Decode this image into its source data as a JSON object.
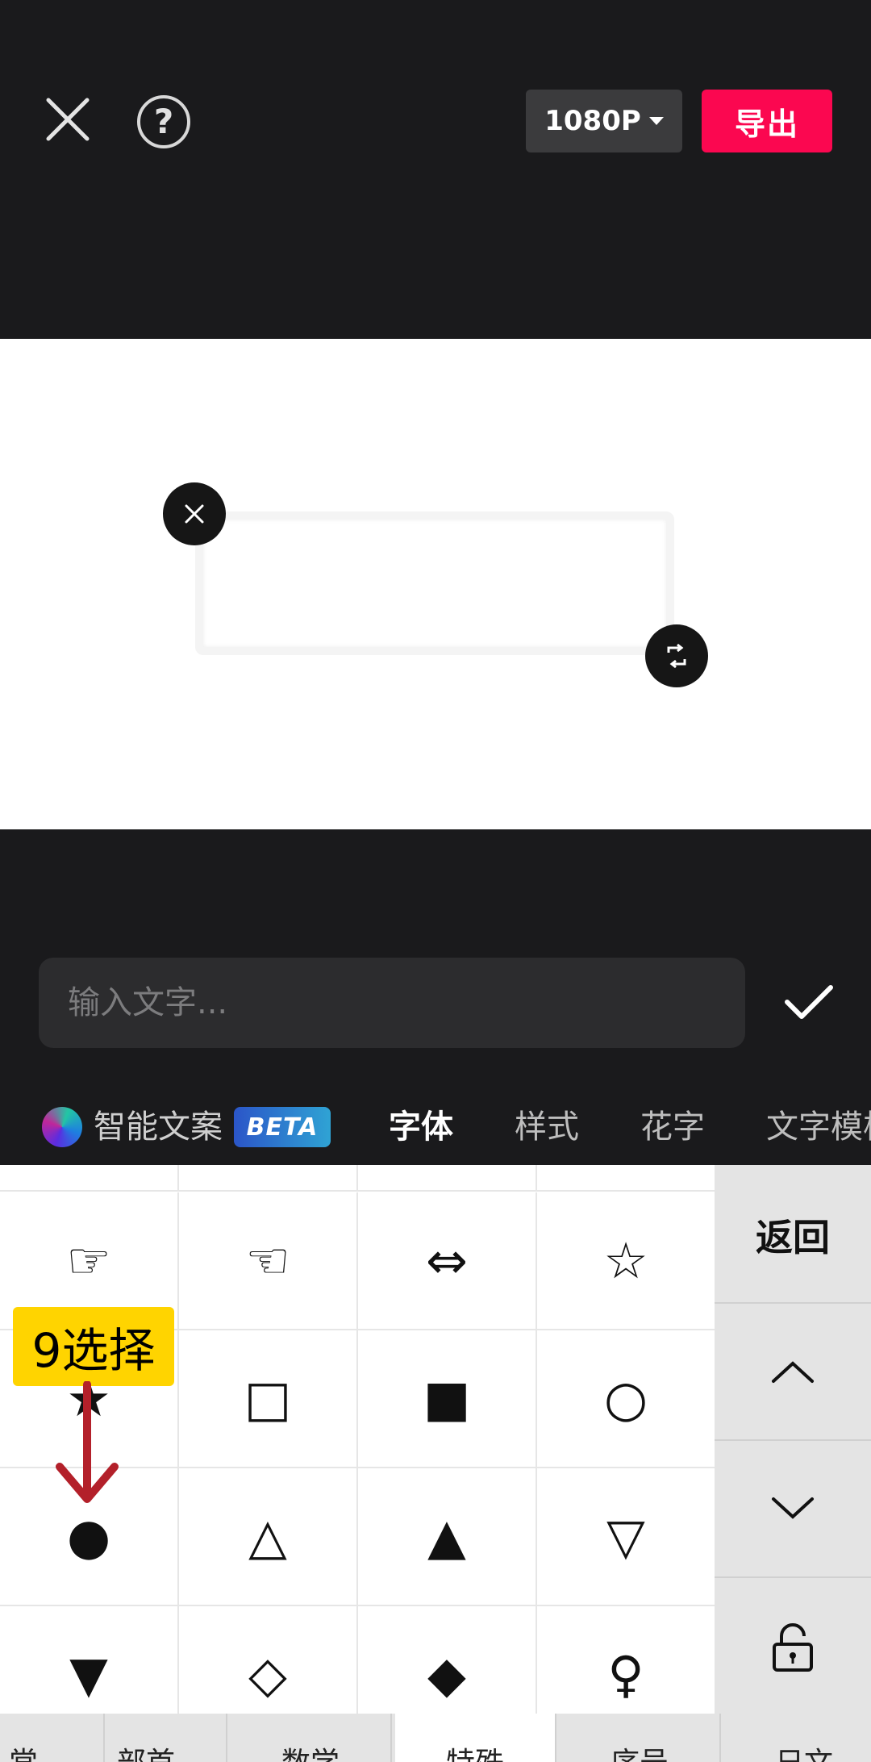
{
  "header": {
    "resolution_label": "1080P",
    "export_label": "导出"
  },
  "editor": {
    "input_placeholder": "输入文字...",
    "input_value": "",
    "tabs": {
      "ai_copy": "智能文案",
      "beta_badge": "BETA",
      "font": "字体",
      "style": "样式",
      "flower_text": "花字",
      "text_template": "文字模板"
    }
  },
  "keyboard": {
    "symbols": [
      [
        "",
        "",
        "",
        ""
      ],
      [
        "☞",
        "☜",
        "⇔",
        "☆"
      ],
      [
        "★",
        "□",
        "■",
        "○"
      ],
      [
        "●",
        "△",
        "▲",
        "▽"
      ],
      [
        "▼",
        "◇",
        "◆",
        "♀"
      ]
    ],
    "side": {
      "back_label": "返回",
      "up_icon": "chevron-up-icon",
      "down_icon": "chevron-down-icon",
      "lock_icon": "lock-icon"
    },
    "categories": [
      "常",
      "部首",
      "数学",
      "特殊",
      "序号",
      "日文"
    ]
  },
  "overlay": {
    "step_label": "9选择",
    "highlight_color": "#ffd400",
    "arrow_color": "#b3202a"
  },
  "colors": {
    "accent": "#fb0750",
    "background": "#1a1a1c"
  }
}
